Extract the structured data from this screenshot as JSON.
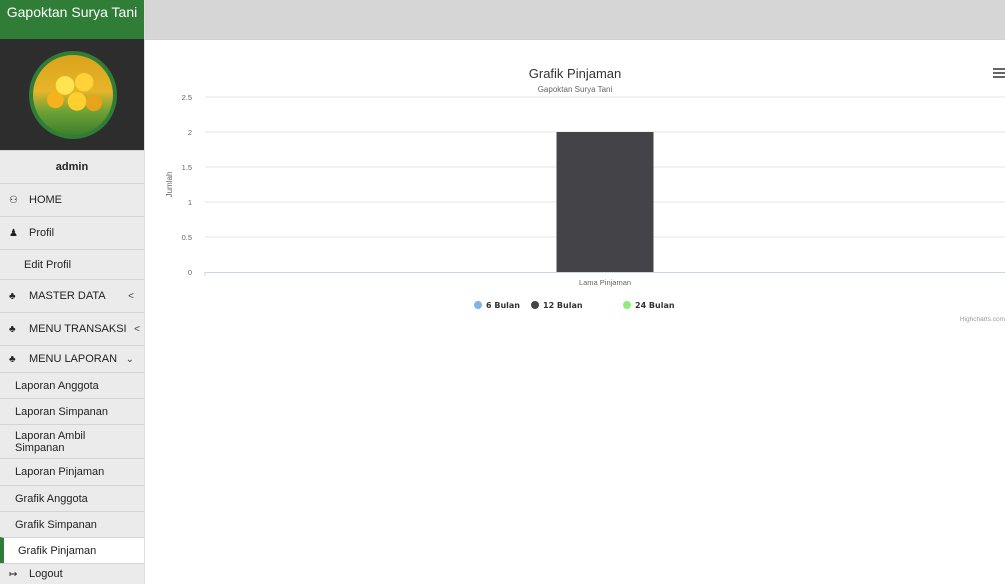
{
  "app": {
    "brand": "Gapoktan Surya Tani",
    "user": "admin"
  },
  "sidebar": {
    "items": [
      {
        "label": "HOME",
        "icon": "dashboard-icon"
      },
      {
        "label": "Profil",
        "icon": "user-icon"
      },
      {
        "label": "Edit Profil"
      },
      {
        "label": "MASTER DATA",
        "icon": "sitemap-icon",
        "chevron": "<"
      },
      {
        "label": "MENU TRANSAKSI",
        "icon": "sitemap-icon",
        "chevron": "<"
      },
      {
        "label": "MENU LAPORAN",
        "icon": "sitemap-icon",
        "chevron": "⌄"
      }
    ],
    "laporan_items": [
      "Laporan Anggota",
      "Laporan Simpanan",
      "Laporan Ambil Simpanan",
      "Laporan Pinjaman",
      "Grafik Anggota",
      "Grafik Simpanan",
      "Grafik Pinjaman"
    ],
    "active_item": "Grafik Pinjaman",
    "logout": {
      "label": "Logout",
      "icon": "sign-out-icon"
    }
  },
  "chart_data": {
    "type": "bar",
    "title": "Grafik Pinjaman",
    "subtitle": "Gapoktan Surya Tani",
    "xlabel": "",
    "ylabel": "Jumlah",
    "categories": [
      "Lama Pinjaman"
    ],
    "series": [
      {
        "name": "6 Bulan",
        "values": [
          0
        ],
        "color": "#7cb5ec"
      },
      {
        "name": "12 Bulan",
        "values": [
          2
        ],
        "color": "#434348"
      },
      {
        "name": "24 Bulan",
        "values": [
          0
        ],
        "color": "#90ed7d"
      }
    ],
    "ylim": [
      0,
      2.5
    ],
    "yticks": [
      "0",
      "0.5",
      "1",
      "1.5",
      "2",
      "2.5"
    ],
    "grid": true,
    "legend": "bottom-center",
    "credits": "Highcharts.com"
  },
  "colors": {
    "brand_green": "#2f7d36",
    "sidebar_bg": "#ebebeb",
    "topbar_bg": "#d6d6d6"
  }
}
